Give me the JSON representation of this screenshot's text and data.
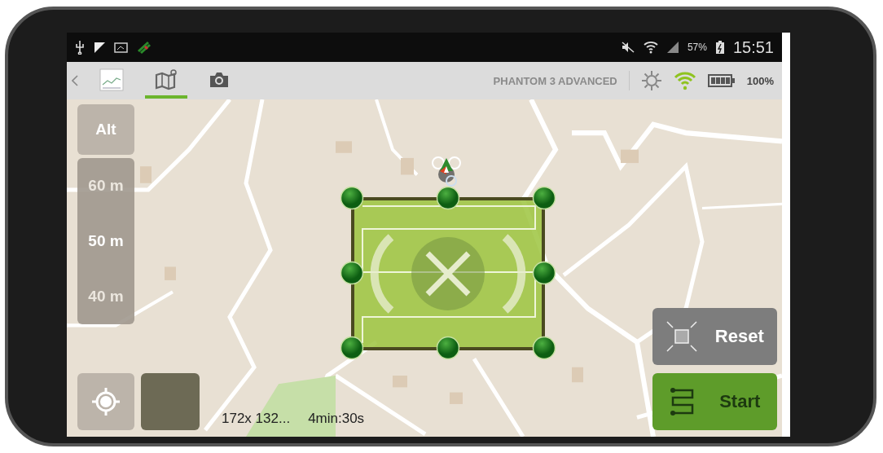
{
  "status_bar": {
    "battery": "57%",
    "time": "15:51"
  },
  "app_bar": {
    "tabs": [
      {
        "kind": "logo",
        "selected": false
      },
      {
        "kind": "map",
        "selected": true
      },
      {
        "kind": "camera",
        "selected": false
      }
    ],
    "aircraft": "PHANTOM 3 ADVANCED",
    "battery": "100%"
  },
  "altitude": {
    "label": "Alt",
    "options": [
      {
        "label": "60 m",
        "selected": false
      },
      {
        "label": "50 m",
        "selected": true
      },
      {
        "label": "40 m",
        "selected": false
      }
    ]
  },
  "info": {
    "size": "172x 132...",
    "duration": "4min:30s"
  },
  "buttons": [
    {
      "kind": "reset",
      "label": "Reset"
    },
    {
      "kind": "start",
      "label": "Start"
    }
  ]
}
